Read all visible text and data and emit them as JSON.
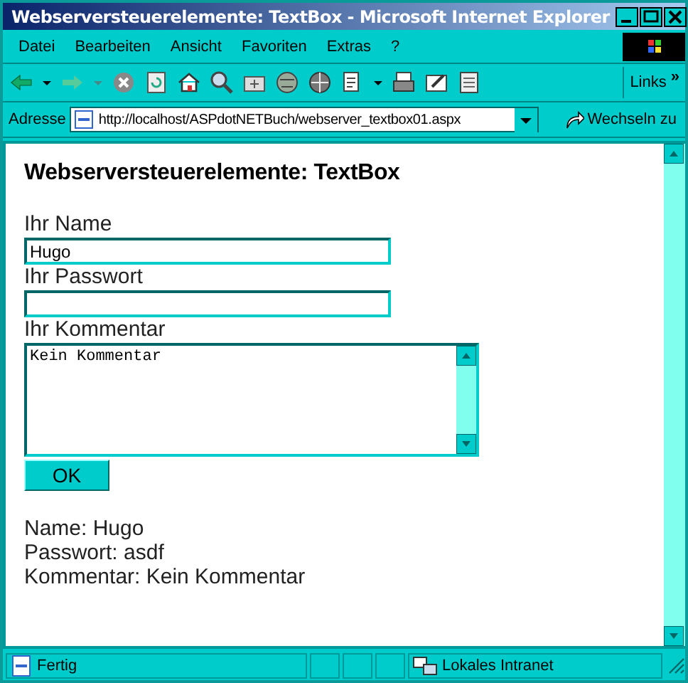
{
  "window": {
    "title": "Webserversteuerelemente: TextBox - Microsoft Internet Explorer"
  },
  "menu": [
    "Datei",
    "Bearbeiten",
    "Ansicht",
    "Favoriten",
    "Extras",
    "?"
  ],
  "toolbar": {
    "links_label": "Links",
    "overflow": "»"
  },
  "address_bar": {
    "label": "Adresse",
    "url": "http://localhost/ASPdotNETBuch/webserver_textbox01.aspx",
    "go_button": "Wechseln zu"
  },
  "page": {
    "heading": "Webserversteuerelemente: TextBox",
    "fields": [
      {
        "kind": "text",
        "label": "Ihr Name",
        "value": "Hugo"
      },
      {
        "kind": "password",
        "label": "Ihr Passwort"
      },
      {
        "kind": "textarea",
        "label": "Ihr Kommentar",
        "value": "Kein Kommentar"
      }
    ],
    "button": "OK",
    "results": [
      "Name: Hugo",
      "Passwort: asdf",
      "Kommentar: Kein Kommentar"
    ]
  },
  "status_bar": {
    "text": "Fertig",
    "zone": "Lokales Intranet"
  }
}
